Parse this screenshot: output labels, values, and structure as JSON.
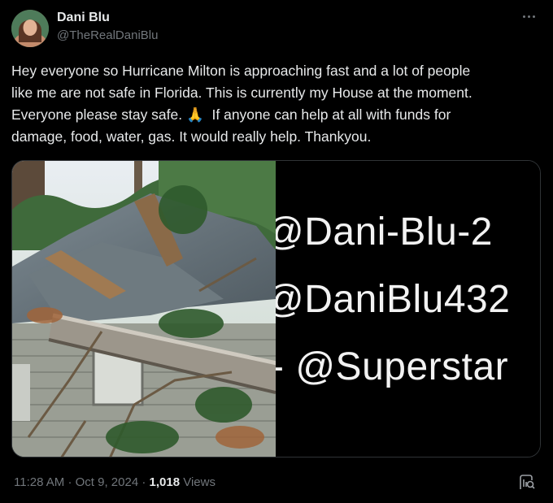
{
  "author": {
    "display_name": "Dani Blu",
    "handle": "@TheRealDaniBlu"
  },
  "tweet": {
    "text": "Hey everyone so Hurricane Milton is approaching fast and a lot of people\nlike me are not safe in Florida. This is currently my House at the moment.\nEveryone please stay safe. 🙏  If anyone can help at all with funds for\ndamage, food, water, gas. It would really help. Thankyou."
  },
  "media": {
    "caption_lines": [
      "@Dani-Blu-2",
      "@DaniBlu432",
      "- @Superstar"
    ]
  },
  "meta": {
    "time": "11:28 AM",
    "date": "Oct 9, 2024",
    "views_count": "1,018",
    "views_label": "Views"
  },
  "icons": {
    "more": "more-dots-icon",
    "stats": "analytics-icon"
  }
}
